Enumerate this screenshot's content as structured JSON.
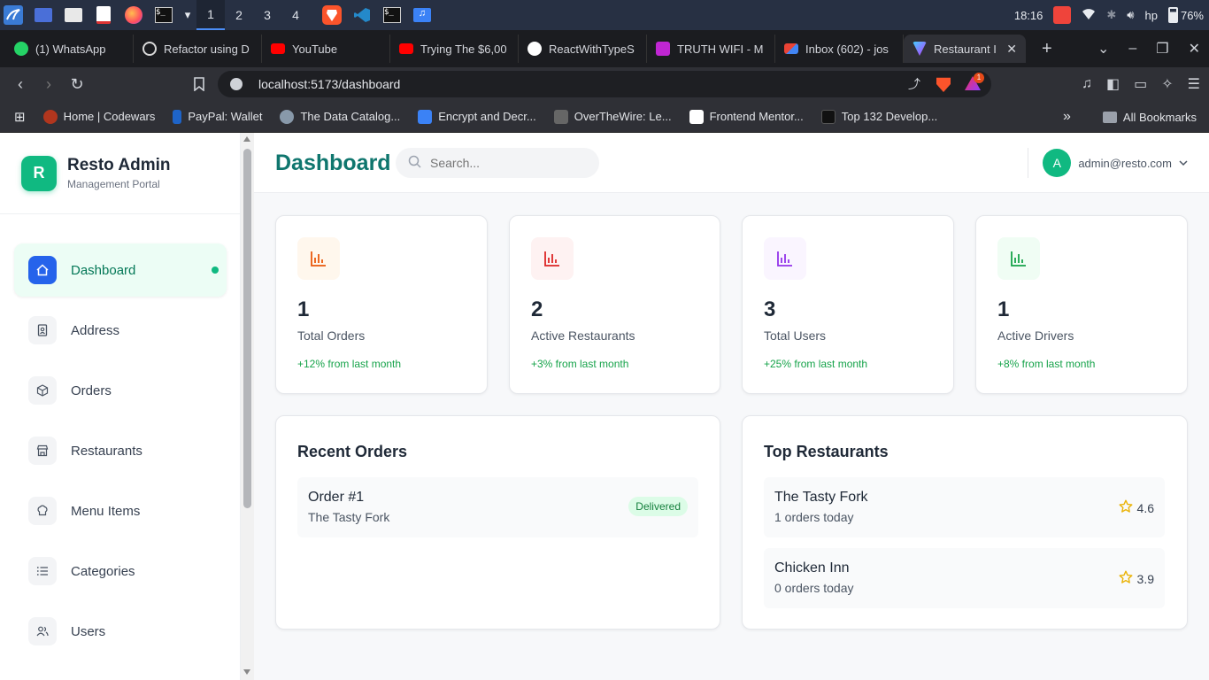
{
  "taskbar": {
    "workspaces": [
      "1",
      "2",
      "3",
      "4"
    ],
    "active_workspace": "1",
    "clock": "18:16",
    "user": "hp",
    "battery": "76%"
  },
  "browser": {
    "tabs": [
      {
        "title": "(1) WhatsApp",
        "favicon_color": "#25d366"
      },
      {
        "title": "Refactor using D",
        "favicon_color": "#d9d9d9"
      },
      {
        "title": "YouTube",
        "favicon_color": "#ff0000"
      },
      {
        "title": "Trying The $6,00",
        "favicon_color": "#ff0000"
      },
      {
        "title": "ReactWithTypeS",
        "favicon_color": "#ffffff"
      },
      {
        "title": "TRUTH WIFI - M",
        "favicon_color": "#c026d3"
      },
      {
        "title": "Inbox (602) - jos",
        "favicon_color": "#ea4335"
      },
      {
        "title": "Restaurant I",
        "favicon_color": "#a78bfa"
      }
    ],
    "active_tab": 7,
    "url": "localhost:5173/dashboard",
    "shield_badge": "1",
    "bookmarks": [
      {
        "title": "Home | Codewars",
        "favicon_color": "#b1361e"
      },
      {
        "title": "PayPal: Wallet",
        "favicon_color": "#1e64c8"
      },
      {
        "title": "The Data Catalog...",
        "favicon_color": "#8899aa"
      },
      {
        "title": "Encrypt and Decr...",
        "favicon_color": "#3b82f6"
      },
      {
        "title": "OverTheWire: Le...",
        "favicon_color": "#666666"
      },
      {
        "title": "Frontend Mentor...",
        "favicon_color": "#ffffff"
      },
      {
        "title": "Top 132 Develop...",
        "favicon_color": "#111111"
      }
    ],
    "all_bookmarks_label": "All Bookmarks"
  },
  "sidebar": {
    "logo_letter": "R",
    "title": "Resto Admin",
    "subtitle": "Management Portal",
    "items": [
      {
        "label": "Dashboard",
        "icon": "home-icon",
        "active": true
      },
      {
        "label": "Address",
        "icon": "address-book-icon",
        "active": false
      },
      {
        "label": "Orders",
        "icon": "package-icon",
        "active": false
      },
      {
        "label": "Restaurants",
        "icon": "store-icon",
        "active": false
      },
      {
        "label": "Menu Items",
        "icon": "chef-hat-icon",
        "active": false
      },
      {
        "label": "Categories",
        "icon": "list-icon",
        "active": false
      },
      {
        "label": "Users",
        "icon": "users-icon",
        "active": false
      }
    ]
  },
  "header": {
    "title": "Dashboard",
    "search_placeholder": "Search...",
    "avatar_letter": "A",
    "user_email": "admin@resto.com"
  },
  "stats": [
    {
      "value": "1",
      "label": "Total Orders",
      "change": "+12% from last month",
      "icon_color": "#ea580c",
      "icon_bg": "#fff7ed"
    },
    {
      "value": "2",
      "label": "Active Restaurants",
      "change": "+3% from last month",
      "icon_color": "#dc2626",
      "icon_bg": "#fef2f2"
    },
    {
      "value": "3",
      "label": "Total Users",
      "change": "+25% from last month",
      "icon_color": "#9333ea",
      "icon_bg": "#faf5ff"
    },
    {
      "value": "1",
      "label": "Active Drivers",
      "change": "+8% from last month",
      "icon_color": "#16a34a",
      "icon_bg": "#f0fdf4"
    }
  ],
  "recent_orders": {
    "title": "Recent Orders",
    "items": [
      {
        "order": "Order #1",
        "restaurant": "The Tasty Fork",
        "status": "Delivered"
      }
    ]
  },
  "top_restaurants": {
    "title": "Top Restaurants",
    "items": [
      {
        "name": "The Tasty Fork",
        "orders": "1 orders today",
        "rating": "4.6"
      },
      {
        "name": "Chicken Inn",
        "orders": "0 orders today",
        "rating": "3.9"
      }
    ]
  }
}
